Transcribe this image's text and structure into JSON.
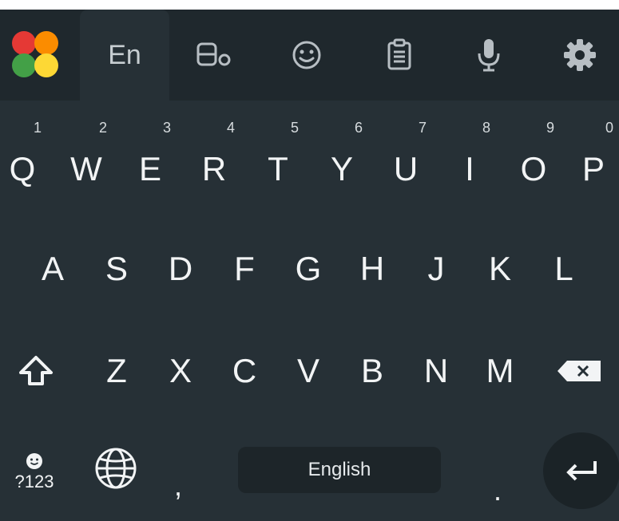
{
  "toolbar": {
    "language_tab": "En",
    "icons": [
      "app-logo-icon",
      "text-style-icon",
      "emoji-icon",
      "clipboard-icon",
      "microphone-icon",
      "gear-icon"
    ]
  },
  "keys": {
    "row1": [
      {
        "letter": "Q",
        "hint": "1"
      },
      {
        "letter": "W",
        "hint": "2"
      },
      {
        "letter": "E",
        "hint": "3"
      },
      {
        "letter": "R",
        "hint": "4"
      },
      {
        "letter": "T",
        "hint": "5"
      },
      {
        "letter": "Y",
        "hint": "6"
      },
      {
        "letter": "U",
        "hint": "7"
      },
      {
        "letter": "I",
        "hint": "8"
      },
      {
        "letter": "O",
        "hint": "9"
      },
      {
        "letter": "P",
        "hint": "0"
      }
    ],
    "row2": [
      "A",
      "S",
      "D",
      "F",
      "G",
      "H",
      "J",
      "K",
      "L"
    ],
    "row3": [
      "Z",
      "X",
      "C",
      "V",
      "B",
      "N",
      "M"
    ]
  },
  "bottom": {
    "symbols_label": "?123",
    "comma": ",",
    "space_label": "English",
    "period": "."
  },
  "colors": {
    "background": "#263036",
    "toolbar": "#1f282d",
    "key_text": "#f2f4f5",
    "logo_red": "#e53935",
    "logo_orange": "#fb8c00",
    "logo_green": "#43a047",
    "logo_yellow": "#fdd835"
  }
}
